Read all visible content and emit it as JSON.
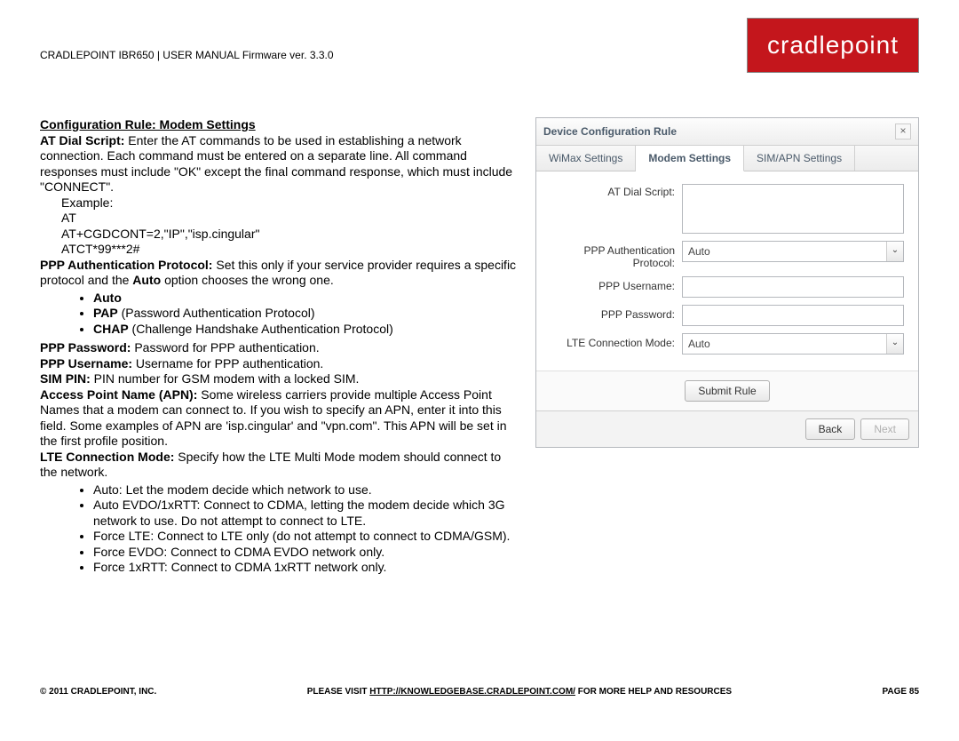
{
  "header": {
    "doc_line": "CRADLEPOINT IBR650 | USER MANUAL Firmware ver. 3.3.0",
    "logo": "cradlepoint"
  },
  "section_title": "Configuration Rule: Modem Settings",
  "para1_label": "AT Dial Script:",
  "para1_text": " Enter the AT commands to be used in establishing a network connection. Each command must be entered on a separate line. All command responses must include \"OK\" except the final command response, which must include \"CONNECT\".",
  "example_label": "Example:",
  "example_lines": [
    "AT",
    "AT+CGDCONT=2,\"IP\",\"isp.cingular\"",
    "ATCT*99***2#"
  ],
  "para2_label": "PPP Authentication Protocol:",
  "para2_text_a": " Set this only if your service provider requires a specific protocol and the ",
  "para2_auto": "Auto",
  "para2_text_b": " option chooses the wrong one.",
  "auth_bullets": [
    {
      "bold": "Auto",
      "rest": ""
    },
    {
      "bold": "PAP",
      "rest": " (Password Authentication Protocol)"
    },
    {
      "bold": "CHAP",
      "rest": " (Challenge Handshake Authentication Protocol)"
    }
  ],
  "ppp_pass_label": "PPP Password:",
  "ppp_pass_text": " Password for PPP authentication.",
  "ppp_user_label": "PPP Username:",
  "ppp_user_text": " Username for PPP authentication.",
  "sim_pin_label": "SIM PIN:",
  "sim_pin_text": " PIN number for GSM modem with a locked SIM.",
  "apn_label": "Access Point Name (APN):",
  "apn_text": " Some wireless carriers provide multiple Access Point Names that a modem can connect to. If you wish to specify an APN, enter it into this field. Some examples of APN are 'isp.cingular' and \"vpn.com\". This APN will be set in the first profile position.",
  "lte_label": "LTE Connection Mode:",
  "lte_text": " Specify how the LTE Multi Mode modem should connect to the network.",
  "lte_bullets": [
    "Auto: Let the modem decide which network to use.",
    "Auto EVDO/1xRTT: Connect to CDMA, letting the modem decide which 3G network to use. Do not attempt to connect to LTE.",
    "Force LTE: Connect to LTE only (do not attempt to connect to CDMA/GSM).",
    "Force EVDO: Connect to CDMA EVDO network only.",
    "Force 1xRTT: Connect to CDMA 1xRTT network only."
  ],
  "dialog": {
    "title": "Device Configuration Rule",
    "tabs": [
      "WiMax Settings",
      "Modem Settings",
      "SIM/APN Settings"
    ],
    "active_tab": 1,
    "fields": {
      "at_dial": {
        "label": "AT Dial Script:",
        "value": ""
      },
      "ppp_auth": {
        "label": "PPP Authentication Protocol:",
        "value": "Auto"
      },
      "ppp_user": {
        "label": "PPP Username:",
        "value": ""
      },
      "ppp_pass": {
        "label": "PPP Password:",
        "value": ""
      },
      "lte_mode": {
        "label": "LTE Connection Mode:",
        "value": "Auto"
      }
    },
    "submit": "Submit Rule",
    "back": "Back",
    "next": "Next"
  },
  "footer": {
    "left": "© 2011 CRADLEPOINT, INC.",
    "mid_pre": "PLEASE VISIT ",
    "mid_link": "HTTP://KNOWLEDGEBASE.CRADLEPOINT.COM/",
    "mid_post": " FOR MORE HELP AND RESOURCES",
    "right": "PAGE 85"
  }
}
